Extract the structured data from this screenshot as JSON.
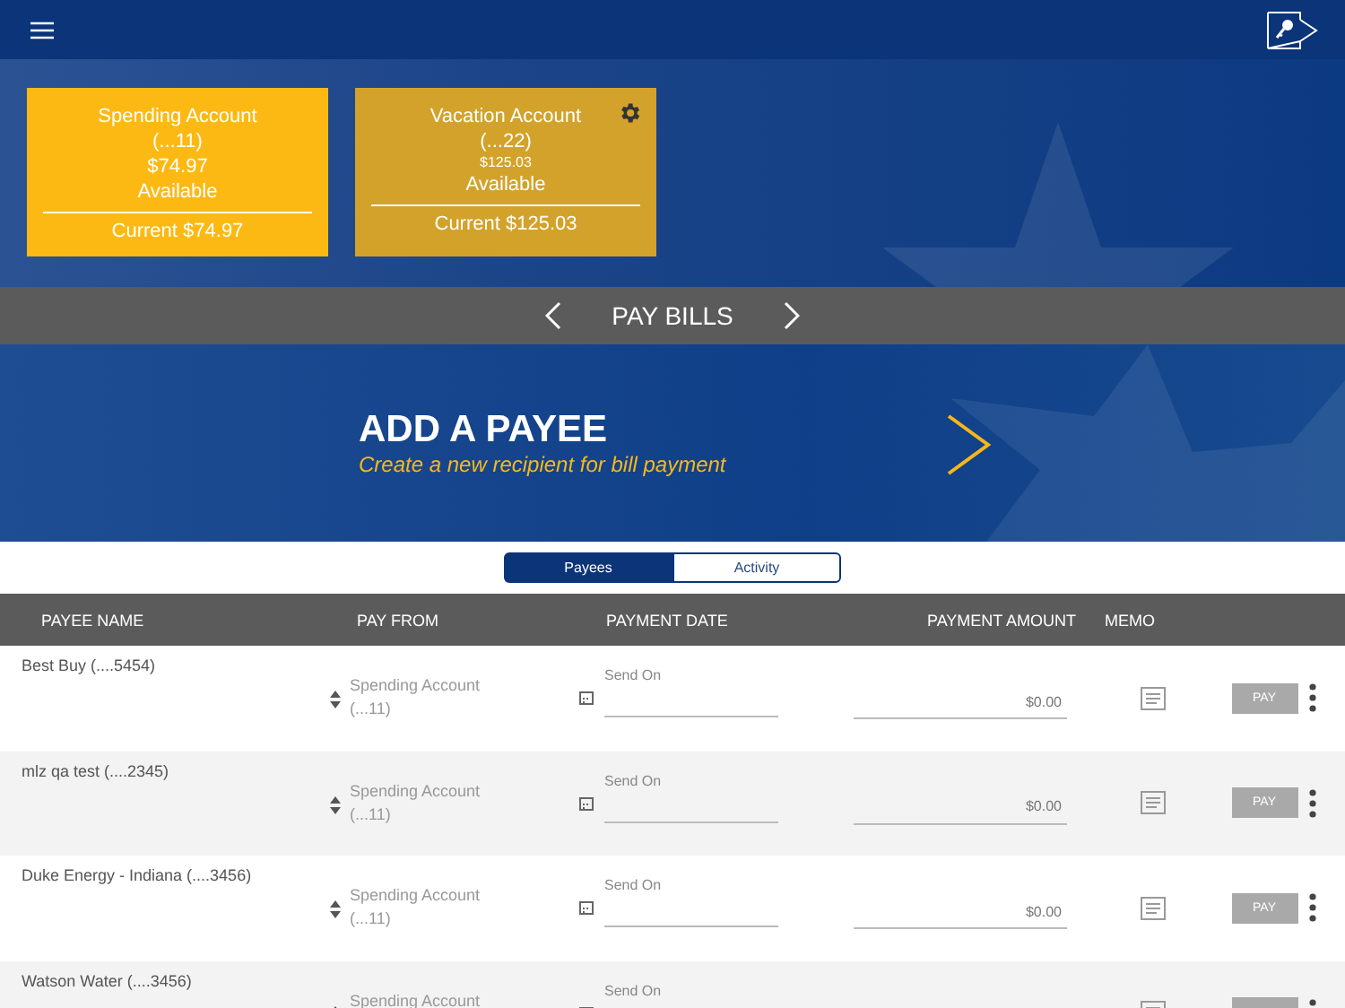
{
  "accounts": [
    {
      "name": "Spending Account",
      "number": "(...11)",
      "balance": "$74.97",
      "available_label": "Available",
      "current": "Current $74.97",
      "selected": true,
      "settings": false
    },
    {
      "name": "Vacation Account",
      "number": "(...22)",
      "balance": "$125.03",
      "available_label": "Available",
      "current": "Current $125.03",
      "selected": false,
      "settings": true
    }
  ],
  "section_title": "PAY BILLS",
  "banner": {
    "title": "ADD A PAYEE",
    "subtitle": "Create a new recipient for bill payment"
  },
  "tabs": [
    {
      "label": "Payees",
      "selected": true
    },
    {
      "label": "Activity",
      "selected": false
    }
  ],
  "table": {
    "columns": [
      "PAYEE NAME",
      "PAY FROM",
      "PAYMENT DATE",
      "PAYMENT AMOUNT",
      "MEMO"
    ],
    "rows": [
      {
        "payee": "Best Buy (....5454)",
        "account": "Spending Account",
        "account_number": "(...11)",
        "date_label": "Send On",
        "amount": "$0.00",
        "pay": "PAY"
      },
      {
        "payee": "mlz qa test (....2345)",
        "account": "Spending Account",
        "account_number": "(...11)",
        "date_label": "Send On",
        "amount": "$0.00",
        "pay": "PAY"
      },
      {
        "payee": "Duke Energy - Indiana (....3456)",
        "account": "Spending Account",
        "account_number": "(...11)",
        "date_label": "Send On",
        "amount": "$0.00",
        "pay": "PAY"
      },
      {
        "payee": "Watson Water (....3456)",
        "account": "Spending Account",
        "date_label": "Send On"
      }
    ]
  }
}
